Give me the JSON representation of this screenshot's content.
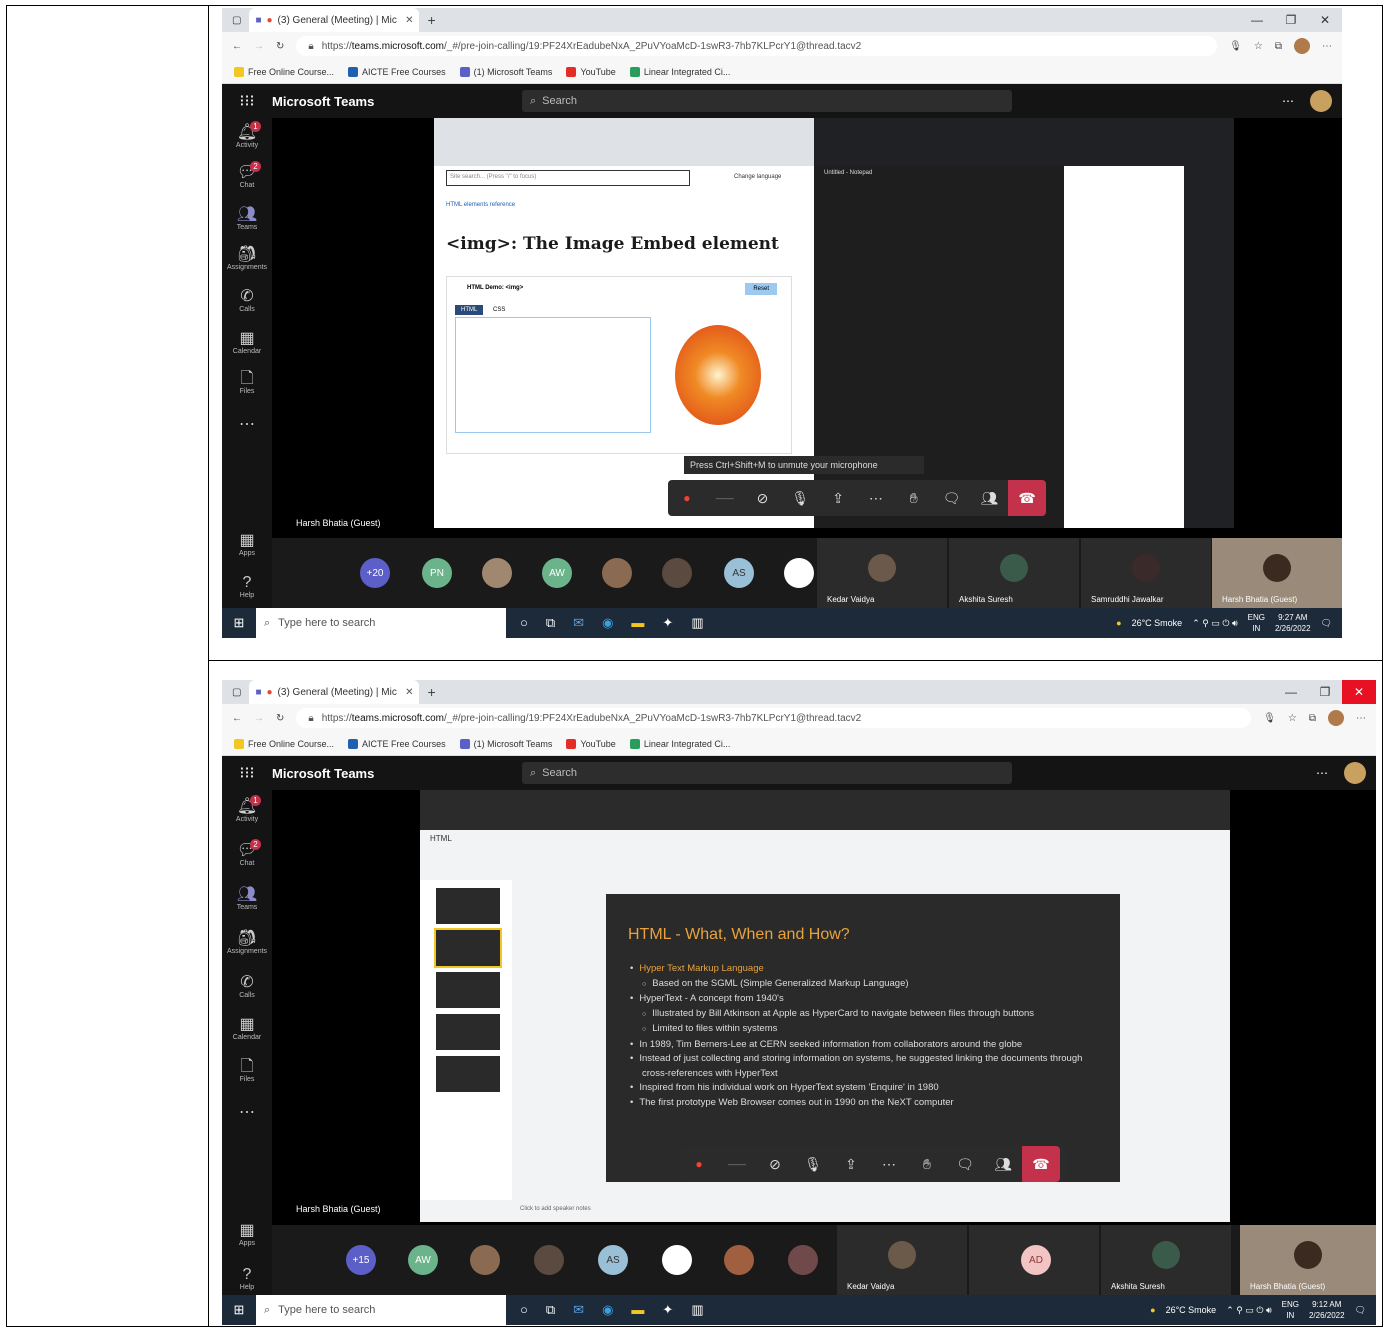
{
  "shot1": {
    "tab_title": "(3) General (Meeting) | Mic",
    "url_prefix": "https://",
    "url_host": "teams.microsoft.com",
    "url_rest": "/_#/pre-join-calling/19:PF24XrEadubeNxA_2PuVYoaMcD-1swR3-7hb7KLPcrY1@thread.tacv2",
    "bookmarks": [
      "Free Online Course...",
      "AICTE Free Courses",
      "(1) Microsoft Teams",
      "YouTube",
      "Linear Integrated Ci..."
    ],
    "app_title": "Microsoft Teams",
    "search": "Search",
    "rail": [
      "Activity",
      "Chat",
      "Teams",
      "Assignments",
      "Calls",
      "Calendar",
      "Files",
      "Apps",
      "Help"
    ],
    "mdn_title": "<img>: The Image Embed element",
    "mdn_crumb": "HTML elements reference",
    "mdn_demo": "HTML Demo: <img>",
    "mdn_reset": "Reset",
    "mdn_tabs": [
      "HTML",
      "CSS"
    ],
    "mdn_search": "Site search... (Press \"/\" to focus)",
    "mdn_lang": "Change language",
    "notepad_title": "Untitled - Notepad",
    "mute_hint": "Press Ctrl+Shift+M to unmute your microphone",
    "guest_name": "Harsh Bhatia (Guest)",
    "avatars": [
      "+20",
      "PN",
      "AW",
      "AS"
    ],
    "tiles": [
      "Kedar Vaidya",
      "Akshita Suresh",
      "Samruddhi Jawalkar",
      "Harsh Bhatia (Guest)"
    ],
    "taskbar_search": "Type here to search",
    "weather": "26°C Smoke",
    "lang": "ENG",
    "region": "IN",
    "time": "9:27 AM",
    "date": "2/26/2022"
  },
  "shot2": {
    "tab_title": "(3) General (Meeting) | Mic",
    "url_prefix": "https://",
    "url_host": "teams.microsoft.com",
    "url_rest": "/_#/pre-join-calling/19:PF24XrEadubeNxA_2PuVYoaMcD-1swR3-7hb7KLPcrY1@thread.tacv2",
    "bookmarks": [
      "Free Online Course...",
      "AICTE Free Courses",
      "(1) Microsoft Teams",
      "YouTube",
      "Linear Integrated Ci..."
    ],
    "app_title": "Microsoft Teams",
    "search": "Search",
    "rail": [
      "Activity",
      "Chat",
      "Teams",
      "Assignments",
      "Calls",
      "Calendar",
      "Files",
      "Apps",
      "Help"
    ],
    "slides_doc": "HTML",
    "slide_title": "HTML - What, When and How?",
    "slide_items": [
      {
        "level": 1,
        "text": "Hyper Text Markup Language"
      },
      {
        "level": 2,
        "text": "Based on the SGML (Simple Generalized Markup Language)"
      },
      {
        "level": 1,
        "text": "HyperText - A concept from 1940's"
      },
      {
        "level": 2,
        "text": "Illustrated by Bill Atkinson at Apple as HyperCard to navigate between files through buttons"
      },
      {
        "level": 2,
        "text": "Limited to files within systems"
      },
      {
        "level": 1,
        "text": "In 1989, Tim Berners-Lee at CERN seeked information from collaborators around the globe"
      },
      {
        "level": 1,
        "text": "Instead of just collecting and storing information on systems, he suggested linking the documents through cross-references with HyperText"
      },
      {
        "level": 1,
        "text": "Inspired from his individual work on HyperText system 'Enquire' in 1980"
      },
      {
        "level": 1,
        "text": "The first prototype Web Browser comes out in 1990 on the NeXT computer"
      }
    ],
    "speaker_notes": "Click to add speaker notes",
    "guest_name": "Harsh Bhatia (Guest)",
    "avatars": [
      "+15",
      "AW",
      "AS",
      "AD"
    ],
    "tiles": [
      "Kedar Vaidya",
      "Akshita Suresh",
      "Harsh Bhatia (Guest)"
    ],
    "taskbar_search": "Type here to search",
    "weather": "26°C Smoke",
    "lang": "ENG",
    "region": "IN",
    "time": "9:12 AM",
    "date": "2/26/2022"
  },
  "colors": {
    "teams_dark": "#141414",
    "accent": "#8b8cc7",
    "hangup": "#c4314b",
    "slide_accent": "#e8a33d"
  }
}
